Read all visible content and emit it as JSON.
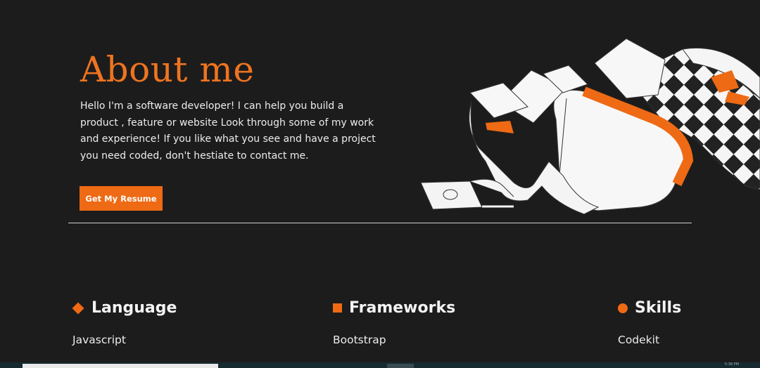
{
  "about": {
    "title": "About me",
    "body": "Hello I'm a software developer! I can help you build a product , feature or website Look through some of my work and experience! If you like what you see and have a project you need coded, don't hestiate to contact me.",
    "resume_button": "Get My Resume"
  },
  "illustration": {
    "icon": "laptop-paper-illustration"
  },
  "columns": [
    {
      "title": "Language",
      "icon": "diamond-icon",
      "items": [
        "Javascript"
      ]
    },
    {
      "title": "Frameworks",
      "icon": "square-icon",
      "items": [
        "Bootstrap"
      ]
    },
    {
      "title": "Skills",
      "icon": "circle-icon",
      "items": [
        "Codekit"
      ]
    }
  ],
  "taskbar": {
    "clock": "5:38 PM"
  },
  "colors": {
    "accent": "#ee6a14",
    "background": "#1d1c1c",
    "text": "#f2f2f2"
  }
}
